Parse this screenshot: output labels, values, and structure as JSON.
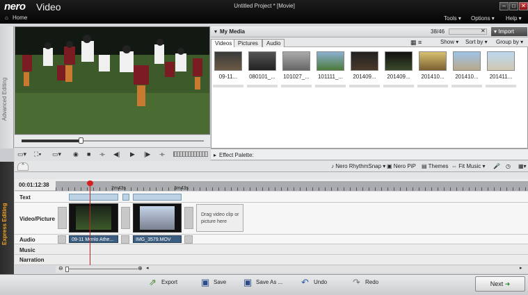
{
  "app": {
    "logo": "nero",
    "product": "Video",
    "window_title": "Untitled Project * [Movie]"
  },
  "nav": {
    "home": "Home",
    "menus": [
      "Tools ▾",
      "Options ▾",
      "Help ▾"
    ]
  },
  "side_tabs": {
    "top": "Advanced Editing",
    "bottom": "Express Editing"
  },
  "media": {
    "title": "My Media",
    "count": "38/46",
    "import_label": "Import",
    "tabs": [
      "Videos",
      "Pictures",
      "Audio"
    ],
    "show_label": "Show",
    "sort_label": "Sort by",
    "group_label": "Group by",
    "thumbs": [
      "09-11...",
      "080101_...",
      "101027_...",
      "101111_...",
      "201409...",
      "201409...",
      "201410...",
      "201410...",
      "201411..."
    ]
  },
  "effect_palette": "Effect Palette:",
  "express_toolbar": {
    "rhythm": "Nero RhythmSnap",
    "pip": "Nero PiP",
    "themes": "Themes",
    "fit": "Fit Music"
  },
  "timeline": {
    "timecode": "00:01:12:38",
    "marks": [
      "2m43s",
      "3m43s"
    ],
    "tracks": [
      "Text",
      "Video/Picture",
      "Audio",
      "Music",
      "Narration"
    ],
    "clips": [
      "09-11 Menlo Athe...",
      "IMG_3579.MOV"
    ],
    "drop_hint": "Drag video clip or picture here"
  },
  "actions": {
    "export": "Export",
    "save": "Save",
    "save_as": "Save As ...",
    "undo": "Undo",
    "redo": "Redo",
    "next": "Next"
  }
}
